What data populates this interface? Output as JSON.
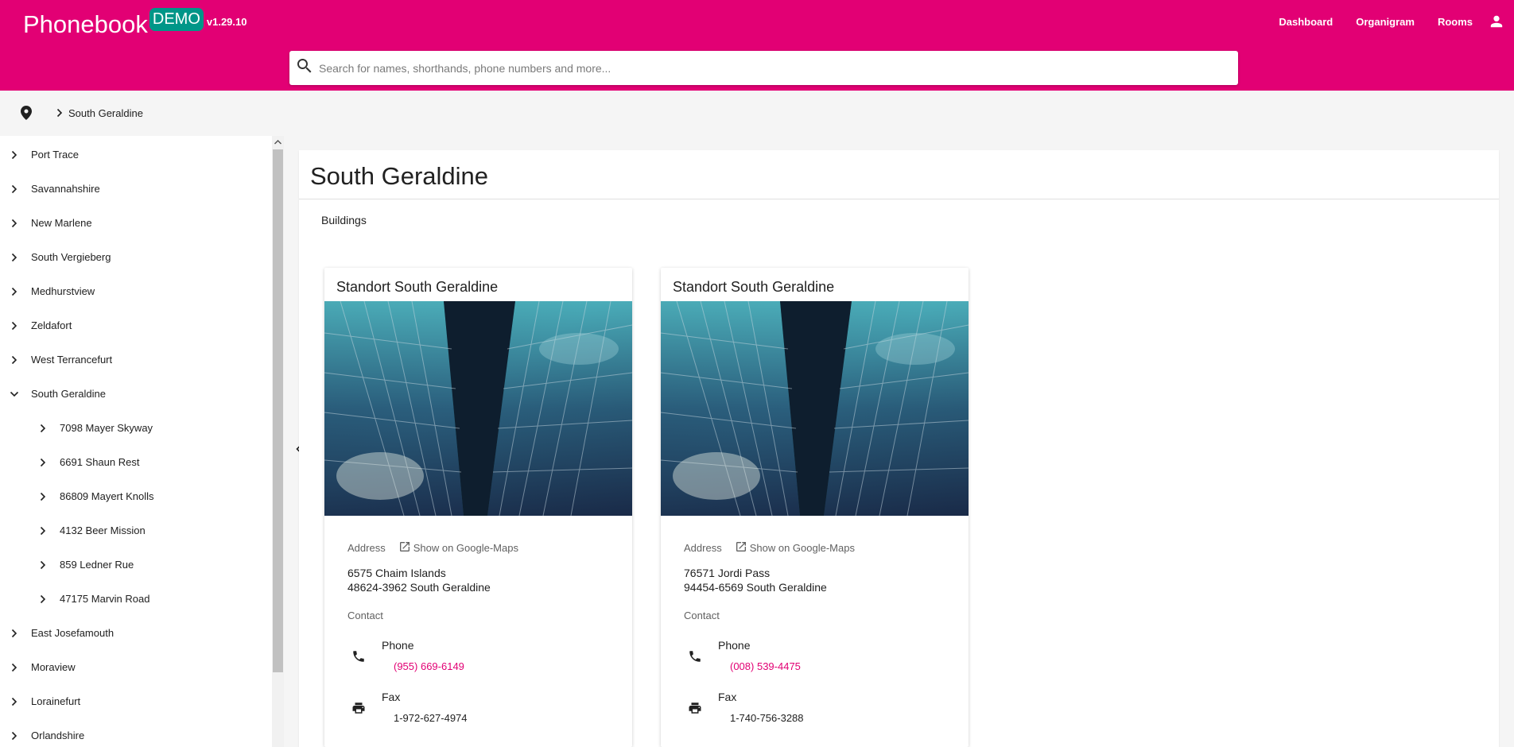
{
  "header": {
    "brand": "Phonebook",
    "badge": "DEMO",
    "version": "v1.29.10",
    "nav": [
      "Dashboard",
      "Organigram",
      "Rooms"
    ],
    "user_icon": "person-icon",
    "color": "#e20074"
  },
  "search": {
    "placeholder": "Search for names, shorthands, phone numbers and more...",
    "value": ""
  },
  "breadcrumb": {
    "icon": "location-pin-icon",
    "current": "South Geraldine"
  },
  "sidebar": {
    "items": [
      {
        "label": "Port Trace",
        "expanded": false,
        "level": 0
      },
      {
        "label": "Savannahshire",
        "expanded": false,
        "level": 0
      },
      {
        "label": "New Marlene",
        "expanded": false,
        "level": 0
      },
      {
        "label": "South Vergieberg",
        "expanded": false,
        "level": 0
      },
      {
        "label": "Medhurstview",
        "expanded": false,
        "level": 0
      },
      {
        "label": "Zeldafort",
        "expanded": false,
        "level": 0
      },
      {
        "label": "West Terrancefurt",
        "expanded": false,
        "level": 0
      },
      {
        "label": "South Geraldine",
        "expanded": true,
        "level": 0
      },
      {
        "label": "7098 Mayer Skyway",
        "expanded": false,
        "level": 1
      },
      {
        "label": "6691 Shaun Rest",
        "expanded": false,
        "level": 1
      },
      {
        "label": "86809 Mayert Knolls",
        "expanded": false,
        "level": 1
      },
      {
        "label": "4132 Beer Mission",
        "expanded": false,
        "level": 1
      },
      {
        "label": "859 Ledner Rue",
        "expanded": false,
        "level": 1
      },
      {
        "label": "47175 Marvin Road",
        "expanded": false,
        "level": 1
      },
      {
        "label": "East Josefamouth",
        "expanded": false,
        "level": 0
      },
      {
        "label": "Moraview",
        "expanded": false,
        "level": 0
      },
      {
        "label": "Lorainefurt",
        "expanded": false,
        "level": 0
      },
      {
        "label": "Orlandshire",
        "expanded": false,
        "level": 0
      }
    ]
  },
  "main": {
    "title": "South Geraldine",
    "tab": "Buildings",
    "cards": [
      {
        "title": "Standort South Geraldine",
        "address_label": "Address",
        "maps_label": "Show on Google-Maps",
        "street": "6575 Chaim Islands",
        "city": "48624-3962 South Geraldine",
        "contact_label": "Contact",
        "phone_label": "Phone",
        "phone": "(955) 669-6149",
        "fax_label": "Fax",
        "fax": "1-972-627-4974"
      },
      {
        "title": "Standort South Geraldine",
        "address_label": "Address",
        "maps_label": "Show on Google-Maps",
        "street": "76571 Jordi Pass",
        "city": "94454-6569 South Geraldine",
        "contact_label": "Contact",
        "phone_label": "Phone",
        "phone": "(008) 539-4475",
        "fax_label": "Fax",
        "fax": "1-740-756-3288"
      }
    ]
  }
}
